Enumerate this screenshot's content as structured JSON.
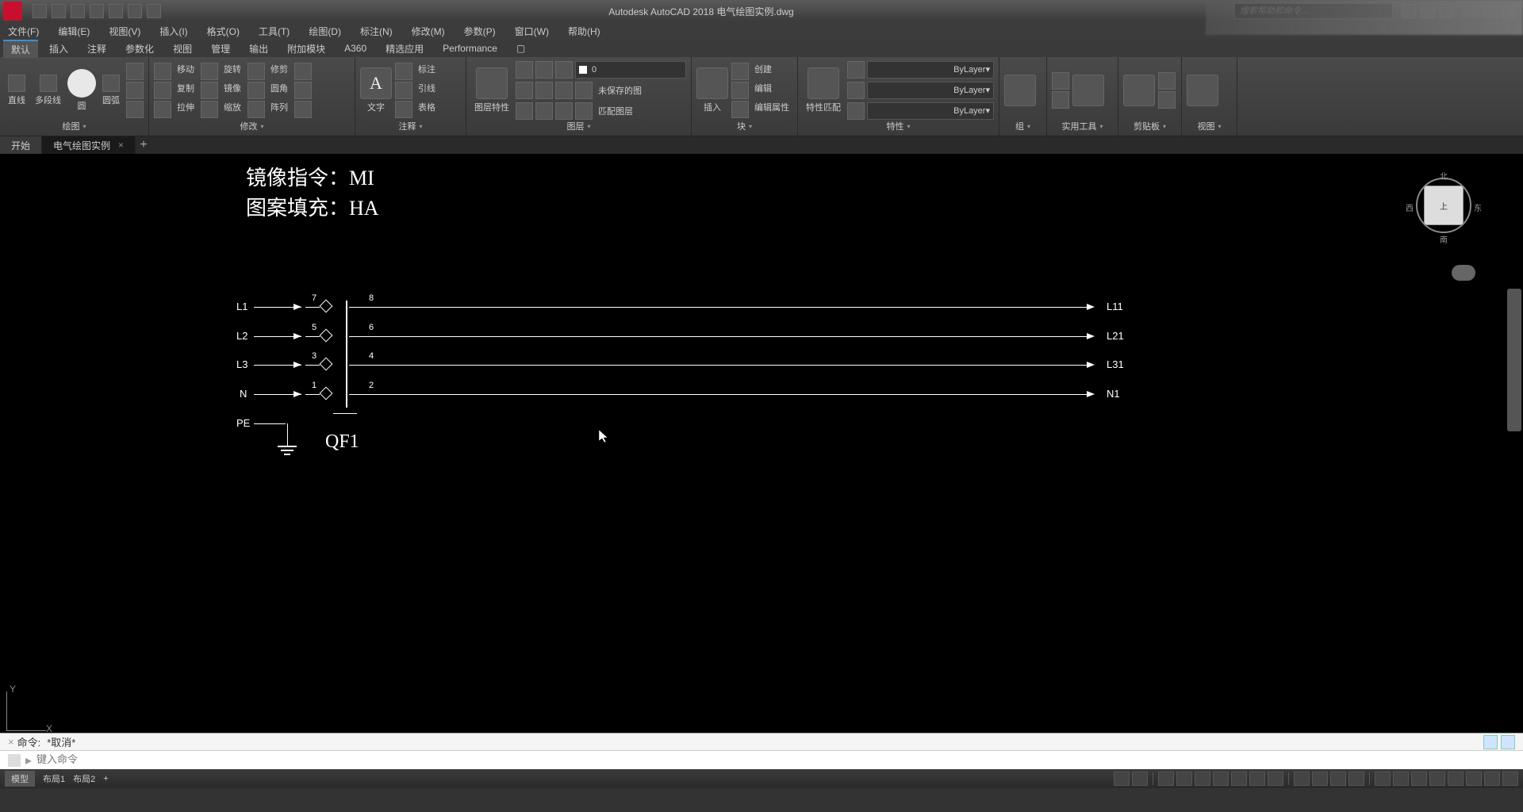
{
  "app": {
    "title": "Autodesk AutoCAD 2018  电气绘图实例.dwg",
    "search_placeholder": "搜索帮助和命令..."
  },
  "menu": [
    "文件(F)",
    "编辑(E)",
    "视图(V)",
    "插入(I)",
    "格式(O)",
    "工具(T)",
    "绘图(D)",
    "标注(N)",
    "修改(M)",
    "参数(P)",
    "窗口(W)",
    "帮助(H)"
  ],
  "ribbon_tabs": [
    "默认",
    "插入",
    "注释",
    "参数化",
    "视图",
    "管理",
    "输出",
    "附加模块",
    "A360",
    "精选应用",
    "Performance",
    "▢"
  ],
  "panels": {
    "draw": "绘图",
    "modify": "修改",
    "annot": "注释",
    "layer": "图层",
    "block": "块",
    "prop": "特性",
    "group": "组",
    "util": "实用工具",
    "clip": "剪贴板",
    "view": "视图"
  },
  "ribbon_labels": {
    "line": "直线",
    "polyline": "多段线",
    "circle": "圆",
    "arc": "圆弧",
    "move": "移动",
    "copy": "复制",
    "stretch": "拉伸",
    "rotate": "旋转",
    "mirror": "镜像",
    "scale": "缩放",
    "trim": "修剪",
    "fillet": "圆角",
    "array": "阵列",
    "text": "文字",
    "dim": "标注",
    "leader": "引线",
    "table": "表格",
    "layer_mgr": "图层特性",
    "unsaved": "未保存的图",
    "match": "匹配图层",
    "insert": "插入",
    "create": "创建",
    "edit": "编辑",
    "edit_attr": "编辑属性",
    "match_prop": "特性匹配"
  },
  "layer": {
    "current": "0",
    "bylayer": "ByLayer",
    "bylayer2": "ByLayer",
    "bylayer3": "ByLayer"
  },
  "file_tabs": {
    "start": "开始",
    "current": "电气绘图实例"
  },
  "canvas_text": {
    "line1": "镜像指令：MI",
    "line2": "图案填充：HA"
  },
  "diagram": {
    "left_labels": [
      "L1",
      "L2",
      "L3",
      "N",
      "PE"
    ],
    "right_labels": [
      "L11",
      "L21",
      "L31",
      "N1"
    ],
    "top_nums": [
      "7",
      "5",
      "3",
      "1"
    ],
    "top_nums_r": [
      "8",
      "6",
      "4",
      "2"
    ],
    "component": "QF1"
  },
  "viewcube": {
    "face": "上",
    "n": "北",
    "s": "南",
    "e": "东",
    "w": "西"
  },
  "ucs": {
    "x": "X",
    "y": "Y"
  },
  "command": {
    "history_prefix": "命令:",
    "history": "*取消*",
    "prompt": "键入命令"
  },
  "status": {
    "left": [
      "模型",
      "布局1",
      "布局2",
      "+"
    ]
  }
}
